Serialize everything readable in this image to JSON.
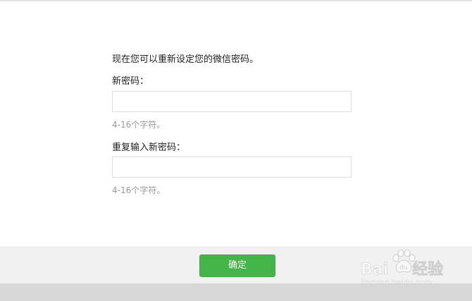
{
  "form": {
    "intro": "现在您可以重新设定您的微信密码。",
    "new_password": {
      "label": "新密码：",
      "value": "",
      "hint": "4-16个字符。"
    },
    "repeat_password": {
      "label": "重复输入新密码：",
      "value": "",
      "hint": "4-16个字符。"
    }
  },
  "footer": {
    "confirm_label": "确定"
  },
  "watermark": {
    "brand_left": "Bai",
    "brand_right": "经验",
    "url": "jingyan.baidu.com"
  },
  "colors": {
    "confirm_button": "#44b549",
    "hint_text": "#999999",
    "footer_background": "#f1f1f1"
  }
}
